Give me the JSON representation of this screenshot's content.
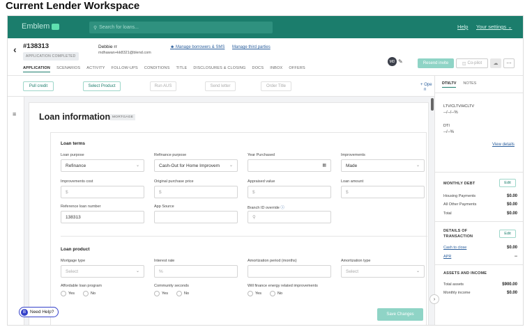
{
  "page_title": "Current Lender Workspace",
  "topbar": {
    "brand": "Emblem",
    "search_placeholder": "Search for loans...",
    "help": "Help",
    "settings": "Your settings"
  },
  "loan": {
    "id": "#138313",
    "status": "APPLICATION COMPLETED",
    "borrower_name": "Debbie rr",
    "borrower_email": "mdhawan+kk8321@blend.com",
    "link_manage_borrowers": "Manage borrowers & SMS",
    "link_manage_third": "Manage third parties",
    "avatar_initials": "MD",
    "resend_invite": "Resend invite",
    "copilot": "Co-pilot"
  },
  "tabs": [
    "APPLICATION",
    "SCENARIOS",
    "ACTIVITY",
    "FOLLOW-UPS",
    "CONDITIONS",
    "TITLE",
    "DISCLOSURES & CLOSING",
    "DOCS",
    "INBOX",
    "OFFERS"
  ],
  "actions": {
    "pull_credit": "Pull credit",
    "select_product": "Select Product",
    "run_aus": "Run AUS",
    "send_letter": "Send letter",
    "order_title": "Order Title",
    "open_line1": "Ope",
    "open_line2": "n"
  },
  "loan_info": {
    "title": "Loan information",
    "badge": "MORTGAGE",
    "loan_terms": {
      "heading": "Loan terms",
      "loan_purpose_label": "Loan purpose",
      "loan_purpose_value": "Refinance",
      "refinance_purpose_label": "Refinance purpose",
      "refinance_purpose_value": "Cash-Out for Home Improvem",
      "year_purchased_label": "Year Purchased",
      "improvements_label": "Improvements",
      "improvements_value": "Made",
      "improvements_cost_label": "Improvements cost",
      "original_price_label": "Original purchase price",
      "appraised_label": "Appraised value",
      "loan_amount_label": "Loan amount",
      "dollar": "$",
      "ref_number_label": "Reference loan number",
      "ref_number_value": "138313",
      "app_source_label": "App Source",
      "branch_label": "Branch ID override"
    },
    "loan_product": {
      "heading": "Loan product",
      "mortgage_type_label": "Mortgage type",
      "mortgage_type_ph": "Select",
      "interest_label": "Interest rate",
      "interest_ph": "%",
      "amort_period_label": "Amortization period (months)",
      "amort_type_label": "Amortization type",
      "amort_type_ph": "Select",
      "affordable_label": "Affordable loan program",
      "community_label": "Community seconds",
      "energy_label": "Will finance energy related improvements",
      "yes": "Yes",
      "no": "No"
    }
  },
  "side": {
    "tab_dti": "DTI/LTV",
    "tab_notes": "NOTES",
    "ltv_label": "LTV/CLTV/HCLTV",
    "ltv_value": "--/--/--%",
    "dti_label": "DTI",
    "dti_value": "--/--%",
    "view_details": "View details",
    "monthly_debt": "MONTHLY DEBT",
    "edit": "Edit",
    "housing_label": "Housing Payments",
    "housing_value": "$0.00",
    "other_label": "All Other Payments",
    "other_value": "$0.00",
    "total_label": "Total",
    "total_value": "$0.00",
    "details_line1": "DETAILS OF",
    "details_line2": "TRANSACTION",
    "cash_close_label": "Cash to close",
    "cash_close_value": "$0.00",
    "apr_label": "APR",
    "apr_value": "--",
    "assets_income": "ASSETS AND INCOME",
    "total_assets_label": "Total assets",
    "total_assets_value": "$900.00",
    "monthly_income_label": "Monthly income",
    "monthly_income_value": "$0.00"
  },
  "footer": {
    "need_help": "Need Help?",
    "save_changes": "Save Changes"
  }
}
